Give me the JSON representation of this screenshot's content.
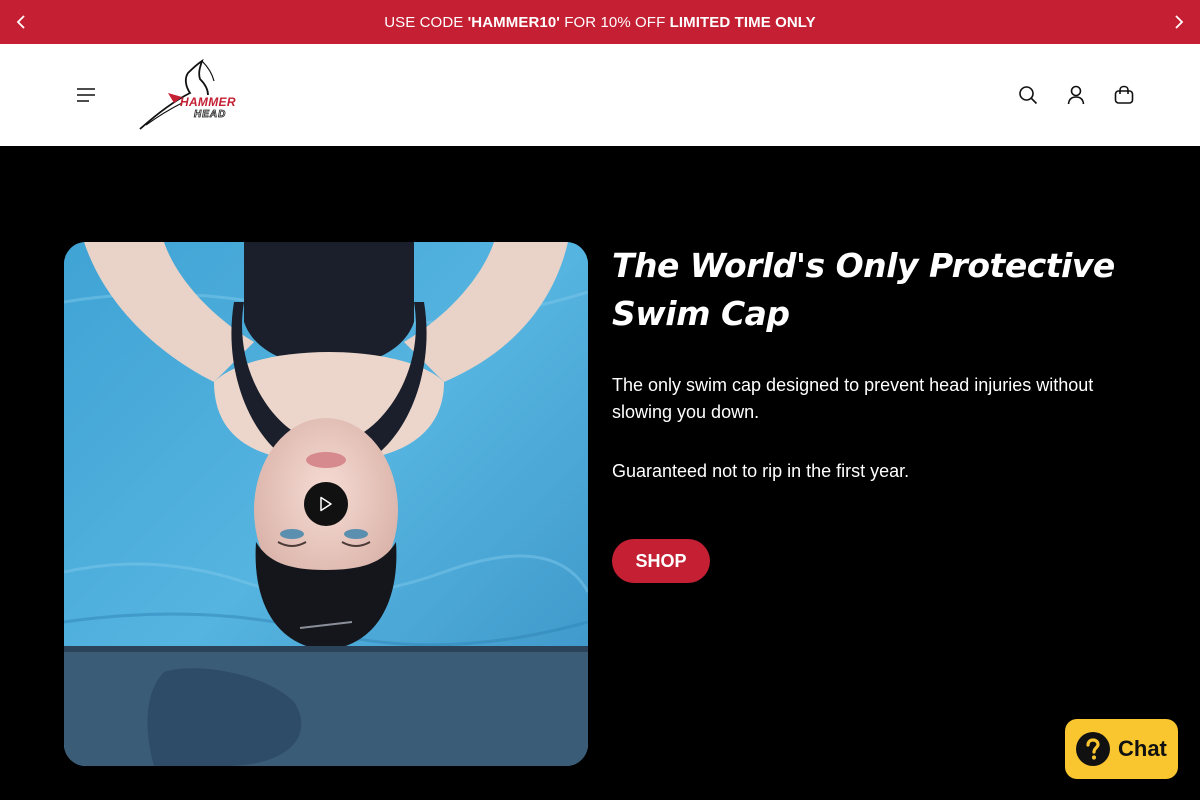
{
  "announcement": {
    "prefix": "USE CODE ",
    "code": "'HAMMER10'",
    "middle": " FOR 10% OFF ",
    "emphasis": "LIMITED TIME ONLY"
  },
  "header": {
    "logo": {
      "line1": "HAMMER",
      "line2": "HEAD"
    },
    "icons": [
      "menu-icon",
      "search-icon",
      "account-icon",
      "cart-icon"
    ]
  },
  "hero": {
    "title": "The World's Only Protective Swim Cap",
    "description": "The only swim cap designed to prevent head injuries without slowing you down.",
    "guarantee": "Guaranteed not to rip in the first year.",
    "cta_label": "SHOP"
  },
  "chat": {
    "label": "Chat"
  },
  "colors": {
    "brand_red": "#c41f33",
    "chat_yellow": "#f9c630",
    "background": "#000000"
  }
}
